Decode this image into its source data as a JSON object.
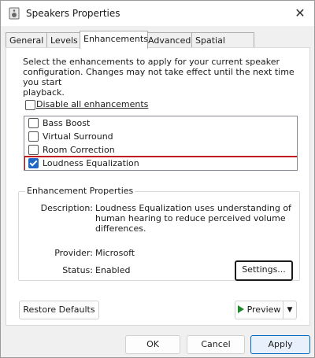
{
  "window": {
    "title": "Speakers Properties",
    "close_glyph": "✕",
    "icon": "speaker-app-icon"
  },
  "tabs": [
    {
      "label": "General",
      "active": false
    },
    {
      "label": "Levels",
      "active": false
    },
    {
      "label": "Enhancements",
      "active": true
    },
    {
      "label": "Advanced",
      "active": false
    },
    {
      "label": "Spatial sound",
      "active": false
    }
  ],
  "enhancements": {
    "description_lines": [
      "Select the enhancements to apply for your current speaker",
      "configuration. Changes may not take effect until the next time you start",
      "playback."
    ],
    "disable_all_label": "Disable all enhancements",
    "disable_all_checked": false,
    "items": [
      {
        "label": "Bass Boost",
        "checked": false
      },
      {
        "label": "Virtual Surround",
        "checked": false
      },
      {
        "label": "Room Correction",
        "checked": false
      },
      {
        "label": "Loudness Equalization",
        "checked": true
      }
    ]
  },
  "properties": {
    "group_title": "Enhancement Properties",
    "description_key": "Description:",
    "description_lines": [
      "Loudness Equalization uses understanding of",
      "human hearing to reduce perceived volume",
      "differences."
    ],
    "provider_key": "Provider:",
    "provider_value": "Microsoft",
    "status_key": "Status:",
    "status_value": "Enabled",
    "settings_label": "Settings..."
  },
  "actions": {
    "restore_defaults_label": "Restore Defaults",
    "preview_label": "Preview"
  },
  "footer": {
    "ok_label": "OK",
    "cancel_label": "Cancel",
    "apply_label": "Apply"
  },
  "colors": {
    "highlight_border": "#c0141e",
    "checkbox_checked": "#1e66c8",
    "preview_play": "#1e8a2a"
  }
}
